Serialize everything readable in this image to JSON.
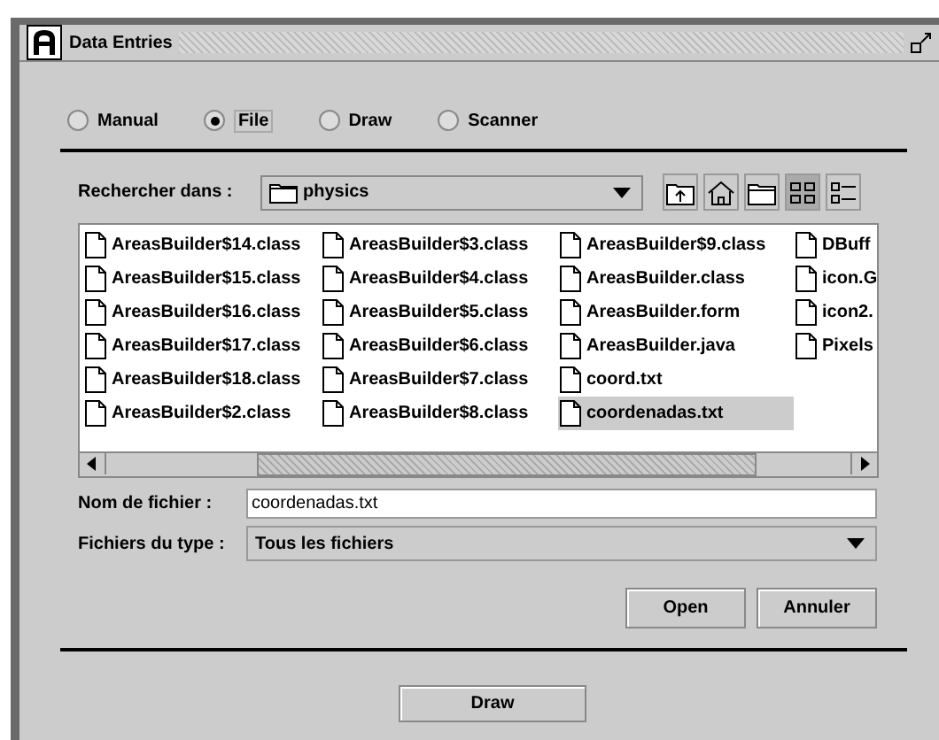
{
  "window": {
    "title": "Data Entries"
  },
  "modes": [
    {
      "label": "Manual",
      "selected": false
    },
    {
      "label": "File",
      "selected": true
    },
    {
      "label": "Draw",
      "selected": false
    },
    {
      "label": "Scanner",
      "selected": false
    }
  ],
  "look_in": {
    "label": "Rechercher dans :",
    "value": "physics"
  },
  "toolbar": [
    {
      "kind": "up",
      "selected": false
    },
    {
      "kind": "home",
      "selected": false
    },
    {
      "kind": "newfolder",
      "selected": false
    },
    {
      "kind": "list",
      "selected": true
    },
    {
      "kind": "details",
      "selected": false
    }
  ],
  "files": [
    {
      "name": "AreasBuilder$14.class",
      "selected": false
    },
    {
      "name": "AreasBuilder$15.class",
      "selected": false
    },
    {
      "name": "AreasBuilder$16.class",
      "selected": false
    },
    {
      "name": "AreasBuilder$17.class",
      "selected": false
    },
    {
      "name": "AreasBuilder$18.class",
      "selected": false
    },
    {
      "name": "AreasBuilder$2.class",
      "selected": false
    },
    {
      "name": "AreasBuilder$3.class",
      "selected": false
    },
    {
      "name": "AreasBuilder$4.class",
      "selected": false
    },
    {
      "name": "AreasBuilder$5.class",
      "selected": false
    },
    {
      "name": "AreasBuilder$6.class",
      "selected": false
    },
    {
      "name": "AreasBuilder$7.class",
      "selected": false
    },
    {
      "name": "AreasBuilder$8.class",
      "selected": false
    },
    {
      "name": "AreasBuilder$9.class",
      "selected": false
    },
    {
      "name": "AreasBuilder.class",
      "selected": false
    },
    {
      "name": "AreasBuilder.form",
      "selected": false
    },
    {
      "name": "AreasBuilder.java",
      "selected": false
    },
    {
      "name": "coord.txt",
      "selected": false
    },
    {
      "name": "coordenadas.txt",
      "selected": true
    },
    {
      "name": "DBuff",
      "selected": false
    },
    {
      "name": "icon.G",
      "selected": false
    },
    {
      "name": "icon2.",
      "selected": false
    },
    {
      "name": "Pixels",
      "selected": false
    }
  ],
  "file_name": {
    "label": "Nom de fichier :",
    "value": "coordenadas.txt"
  },
  "file_type": {
    "label": "Fichiers du type :",
    "value": "Tous les fichiers"
  },
  "buttons": [
    "Open",
    "Annuler"
  ],
  "draw_button": "Draw"
}
